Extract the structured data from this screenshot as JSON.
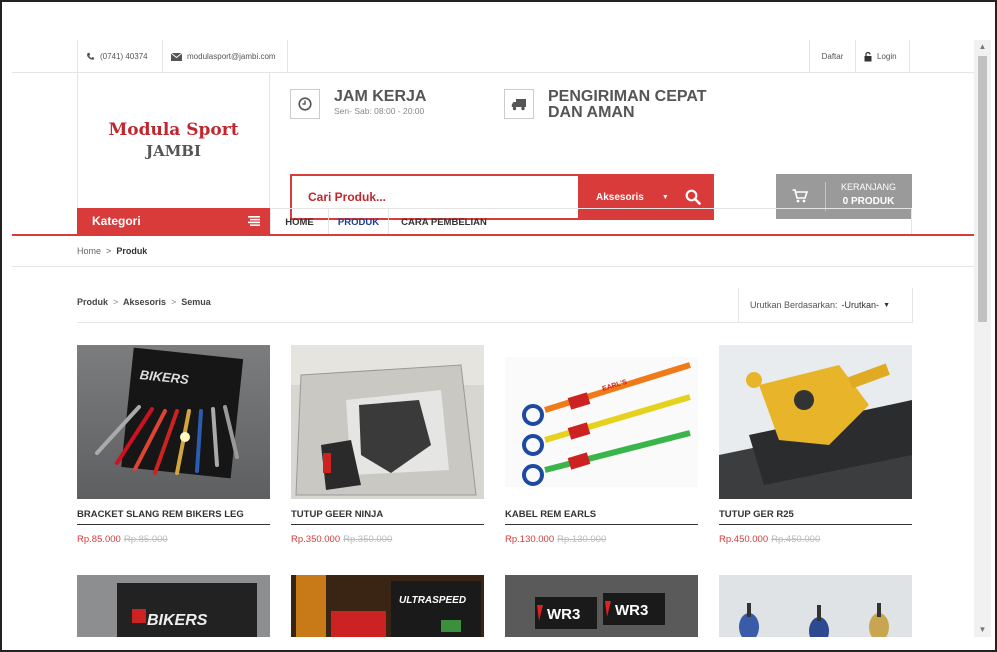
{
  "topbar": {
    "phone": "(0741) 40374",
    "email": "modulasport@jambi.com",
    "daftar": "Daftar",
    "login": "Login"
  },
  "logo": {
    "line1": "Modula Sport",
    "line2": "JAMBI"
  },
  "info": {
    "hours_title": "JAM KERJA",
    "hours_sub": "Sen- Sab: 08:00 - 20:00",
    "shipping_title_1": "PENGIRIMAN CEPAT",
    "shipping_title_2": "DAN AMAN"
  },
  "search": {
    "placeholder": "Cari Produk...",
    "category": "Aksesoris"
  },
  "cart": {
    "label": "KERANJANG",
    "count": "0 PRODUK"
  },
  "nav": {
    "kategori": "Kategori",
    "items": [
      "HOME",
      "PRODUK",
      "CARA PEMBELIAN"
    ]
  },
  "breadcrumb_top": {
    "home": "Home",
    "sep": ">",
    "current": "Produk"
  },
  "breadcrumb_main": {
    "a": "Produk",
    "b": "Aksesoris",
    "c": "Semua",
    "sep": ">"
  },
  "sort": {
    "label": "Urutkan Berdasarkan:",
    "value": "-Urutkan-"
  },
  "products": [
    {
      "name": "BRACKET SLANG REM BIKERS LEG",
      "price": "Rp.85.000",
      "old_price": "Rp.85.000"
    },
    {
      "name": "TUTUP GEER NINJA",
      "price": "Rp.350.000",
      "old_price": "Rp.350.000"
    },
    {
      "name": "KABEL REM EARLS",
      "price": "Rp.130.000",
      "old_price": "Rp.130.000"
    },
    {
      "name": "TUTUP GER R25",
      "price": "Rp.450.000",
      "old_price": "Rp.450.000"
    }
  ],
  "product_image_text": {
    "bikers_1": "BIKERS",
    "earls": "EARL'S",
    "bikers_2": "BIKERS",
    "ultraspeed": "ULTRASPEED",
    "wr3": "WR3"
  },
  "colors": {
    "brand_red": "#d93a3a",
    "nav_active": "#1a3f8f",
    "cart_gray": "#9a9a9a"
  }
}
